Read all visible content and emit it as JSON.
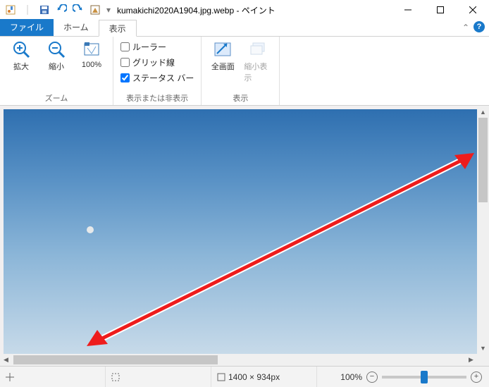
{
  "title": "kumakichi2020A1904.jpg.webp - ペイント",
  "tabs": {
    "file": "ファイル",
    "home": "ホーム",
    "view": "表示"
  },
  "ribbon": {
    "zoom": {
      "in": "拡大",
      "out": "縮小",
      "hundred": "100%",
      "group": "ズーム"
    },
    "showhide": {
      "rulers": "ルーラー",
      "grid": "グリッド線",
      "statusbar": "ステータス バー",
      "group": "表示または非表示",
      "rulers_checked": false,
      "grid_checked": false,
      "statusbar_checked": true
    },
    "display": {
      "fullscreen": "全画面",
      "thumbnail": "縮小表示",
      "group": "表示"
    }
  },
  "status": {
    "pointer": "",
    "selection": "",
    "size_icon": "⬚",
    "size": "1400 × 934px",
    "zoom": "100%"
  },
  "icons": {
    "save": "save-icon",
    "undo": "undo-icon",
    "redo": "redo-icon",
    "app": "paint-icon",
    "dropdown": "chevron-down-icon",
    "min": "minimize-icon",
    "max": "maximize-icon",
    "close": "close-icon",
    "help": "?",
    "collapse": "⌃"
  }
}
